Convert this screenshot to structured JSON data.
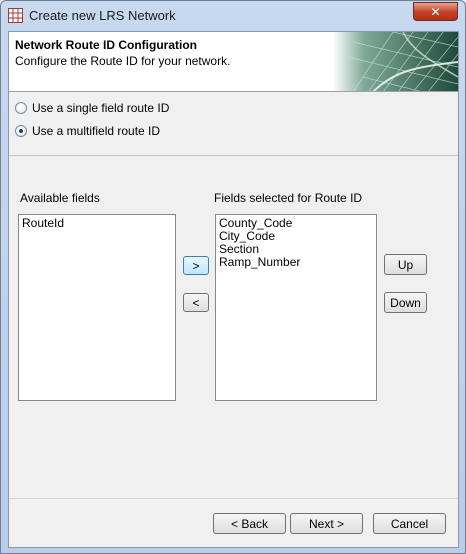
{
  "window": {
    "title": "Create new LRS Network"
  },
  "header": {
    "title": "Network Route ID Configuration",
    "subtitle": "Configure the Route ID for your network."
  },
  "options": {
    "single_label": "Use a single field route ID",
    "multi_label": "Use a multifield route ID",
    "selected": "multi"
  },
  "available": {
    "label": "Available fields",
    "items": [
      "RouteId"
    ]
  },
  "selected_fields": {
    "label": "Fields selected for Route ID",
    "items": [
      "County_Code",
      "City_Code",
      "Section",
      "Ramp_Number"
    ]
  },
  "buttons": {
    "add": ">",
    "remove": "<",
    "up": "Up",
    "down": "Down",
    "back": "< Back",
    "next": "Next >",
    "cancel": "Cancel"
  },
  "colors": {
    "close": "#c7452a",
    "map_dark": "#1f4a3b",
    "map_light": "#a9c9b8"
  }
}
